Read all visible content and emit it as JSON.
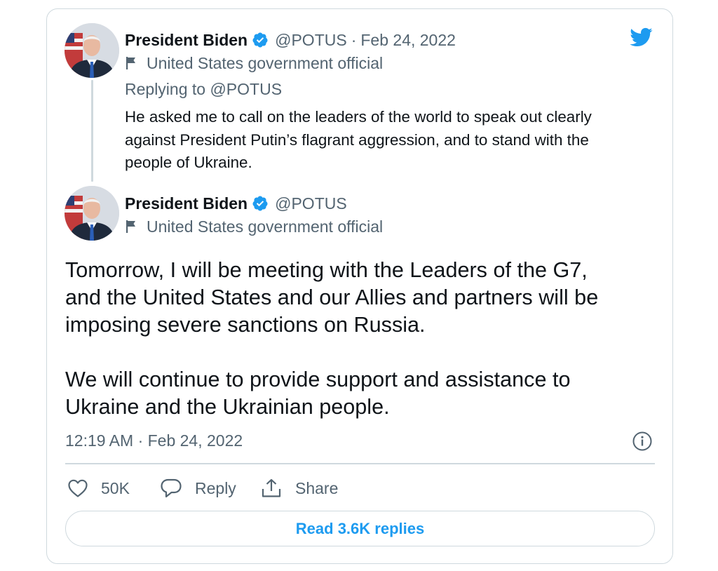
{
  "colors": {
    "twitter_blue": "#1d9bf0",
    "text_primary": "#0f1419",
    "text_secondary": "#536471",
    "border": "#cfd9de"
  },
  "icons": {
    "brand": "twitter-bird-icon",
    "verified": "verified-badge-icon",
    "affiliation": "flag-icon",
    "info": "info-icon",
    "like": "heart-icon",
    "reply": "speech-bubble-icon",
    "share": "share-upload-icon"
  },
  "reply_tweet": {
    "author_name": "President Biden",
    "handle": "@POTUS",
    "separator": "·",
    "date": "Feb 24, 2022",
    "affiliation": "United States government official",
    "replying_to": "Replying to @POTUS",
    "text_lines": [
      "He asked me to call on the leaders of the world to speak out clearly",
      "against President Putin’s flagrant aggression, and to stand with the",
      "people of Ukraine."
    ]
  },
  "main_tweet": {
    "author_name": "President Biden",
    "handle": "@POTUS",
    "affiliation": "United States government official",
    "paragraph1_lines": [
      "Tomorrow, I will be meeting with the Leaders of the G7,",
      "and the United States and our Allies and partners will be",
      "imposing severe sanctions on Russia."
    ],
    "paragraph2_lines": [
      "We will continue to provide support and assistance to",
      "Ukraine and the Ukrainian people."
    ],
    "timestamp": "12:19 AM · Feb 24, 2022",
    "actions": {
      "like_count": "50K",
      "reply_label": "Reply",
      "share_label": "Share"
    },
    "read_replies_label": "Read 3.6K replies"
  }
}
